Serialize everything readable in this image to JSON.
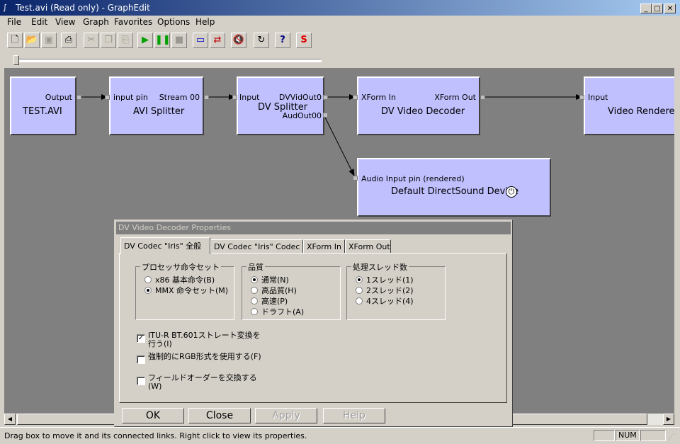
{
  "window": {
    "title": "Test.avi (Read only) - GraphEdit"
  },
  "menu": [
    "File",
    "Edit",
    "View",
    "Graph",
    "Favorites",
    "Options",
    "Help"
  ],
  "filters": {
    "test_avi": {
      "name": "TEST.AVI",
      "out_pin": "Output"
    },
    "avi_splitter": {
      "name": "AVI Splitter",
      "in_pin": "input pin",
      "out_pin": "Stream 00"
    },
    "dv_splitter": {
      "name": "DV Splitter",
      "in_pin": "Input",
      "out_pin_video": "DVVidOut0",
      "out_pin_audio": "AudOut00"
    },
    "dv_decoder": {
      "name": "DV Video Decoder",
      "in_pin": "XForm In",
      "out_pin": "XForm Out"
    },
    "video_renderer": {
      "name": "Video Renderer",
      "in_pin": "Input"
    },
    "dsound": {
      "name": "Default DirectSound Device",
      "in_pin": "Audio Input pin (rendered)"
    }
  },
  "dialog": {
    "title": "DV Video Decoder Properties",
    "tabs": [
      "DV Codec \"Iris\" 全般",
      "DV Codec \"Iris\" Codec",
      "XForm In",
      "XForm Out"
    ],
    "groups": {
      "processor": {
        "label": "プロセッサ命令セット",
        "options": [
          "x86 基本命令(B)",
          "MMX 命令セット(M)"
        ],
        "selected": 1
      },
      "quality": {
        "label": "品質",
        "options": [
          "通常(N)",
          "高品質(H)",
          "高速(P)",
          "ドラフト(A)"
        ],
        "selected": 0
      },
      "threads": {
        "label": "処理スレッド数",
        "options": [
          "1スレッド(1)",
          "2スレッド(2)",
          "4スレッド(4)"
        ],
        "selected": 0
      }
    },
    "checkboxes": [
      {
        "label": "ITU-R BT.601ストレート変換を行う(I)",
        "checked": true
      },
      {
        "label": "強制的にRGB形式を使用する(F)",
        "checked": false
      },
      {
        "label": "フィールドオーダーを交換する(W)",
        "checked": false
      }
    ],
    "buttons": {
      "ok": "OK",
      "close": "Close",
      "apply": "Apply",
      "help": "Help"
    }
  },
  "status": {
    "text": "Drag box to move it and its connected links. Right click to view its properties.",
    "num": "NUM"
  },
  "colors": {
    "filter_fill": "#c0c0ff",
    "canvas": "#808080",
    "titlebar": "#0a246a"
  }
}
